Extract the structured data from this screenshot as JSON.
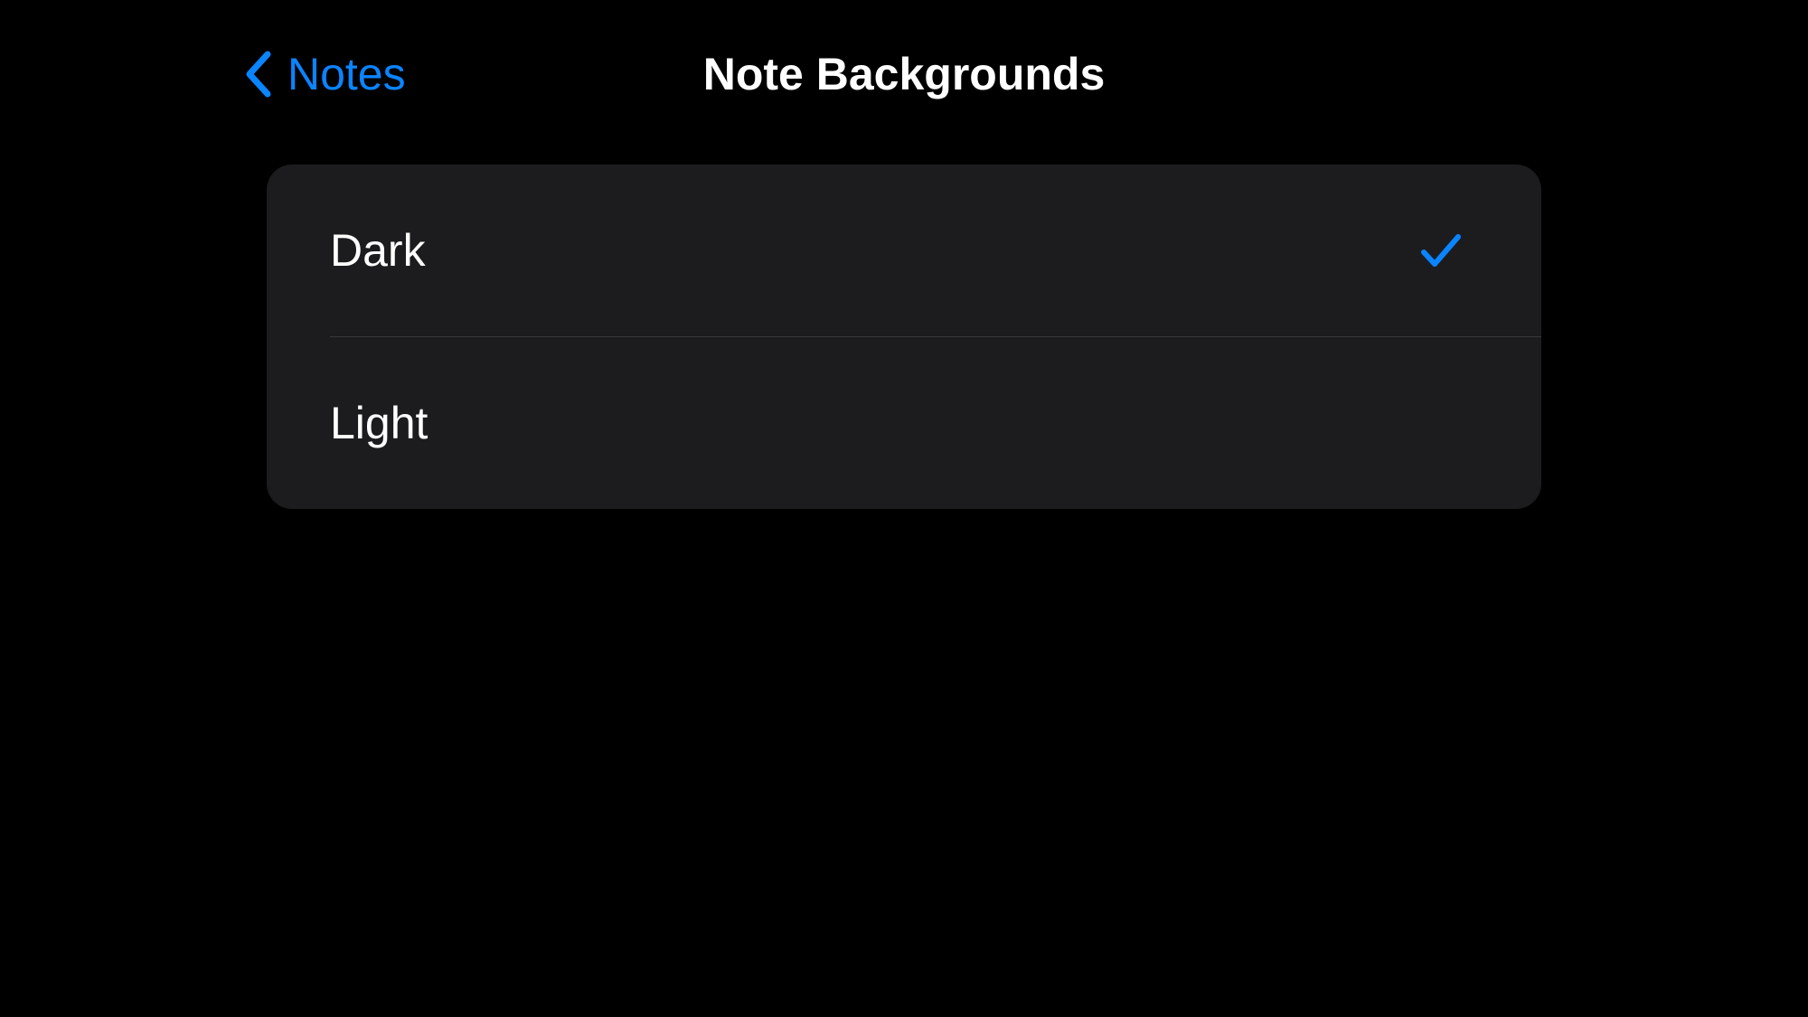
{
  "header": {
    "back_label": "Notes",
    "title": "Note Backgrounds"
  },
  "options": [
    {
      "label": "Dark",
      "selected": true
    },
    {
      "label": "Light",
      "selected": false
    }
  ]
}
